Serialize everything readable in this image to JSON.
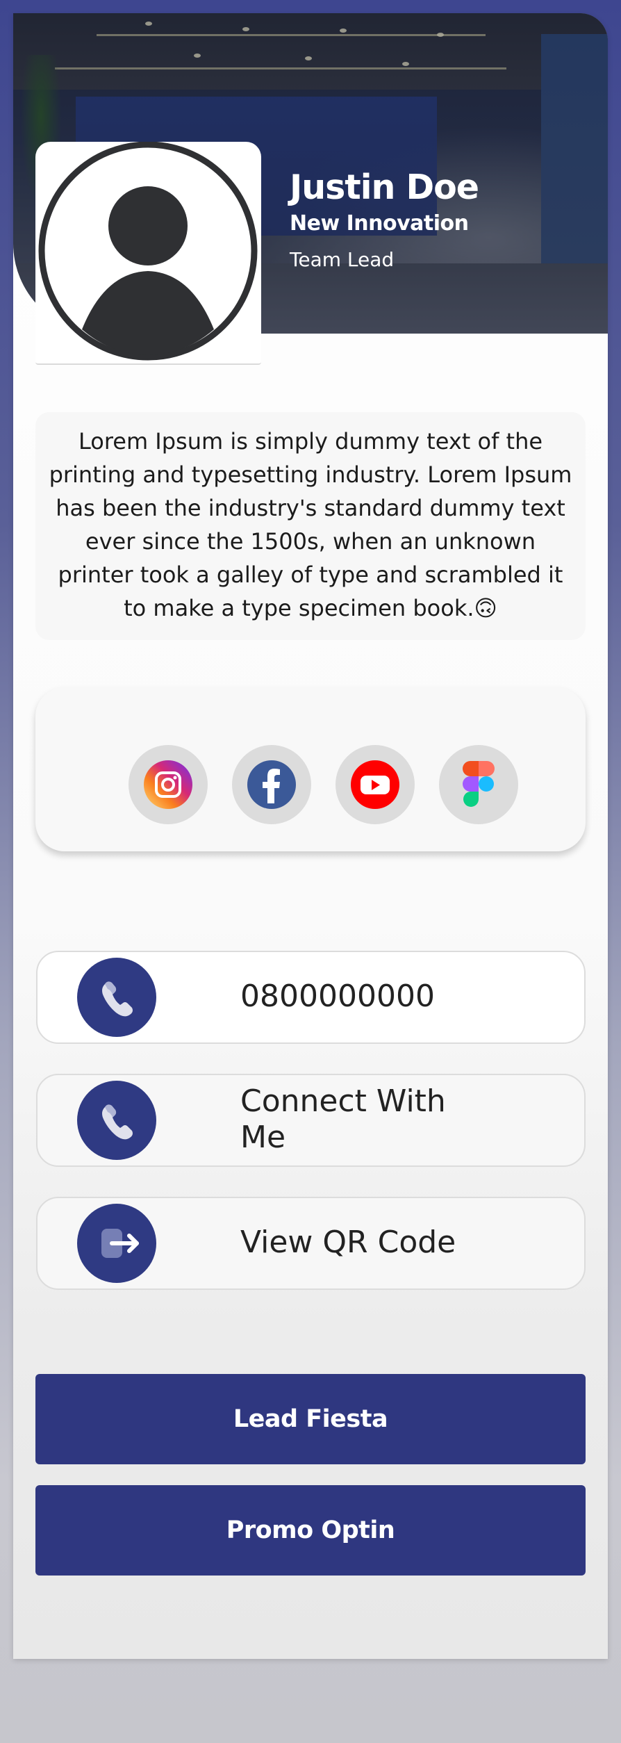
{
  "profile": {
    "name": "Justin Doe",
    "company": "New Innovation",
    "role": "Team Lead"
  },
  "bio": {
    "text": "Lorem Ipsum is simply dummy text of the printing and typesetting industry. Lorem Ipsum has been the industry's standard dummy text ever since the 1500s, when an unknown printer took a galley of type and scrambled it to make a type specimen book.🙃"
  },
  "social": {
    "icons": [
      "instagram-icon",
      "facebook-icon",
      "youtube-icon",
      "figma-icon"
    ]
  },
  "contacts": {
    "phone": "0800000000",
    "connect": "Connect With Me",
    "qr": "View QR Code"
  },
  "buttons": {
    "lead_fiesta": "Lead Fiesta",
    "promo_optin": "Promo Optin"
  },
  "colors": {
    "brand": "#2f3780",
    "icon_circle": "#2f3a83",
    "background_top": "#3e4690"
  }
}
